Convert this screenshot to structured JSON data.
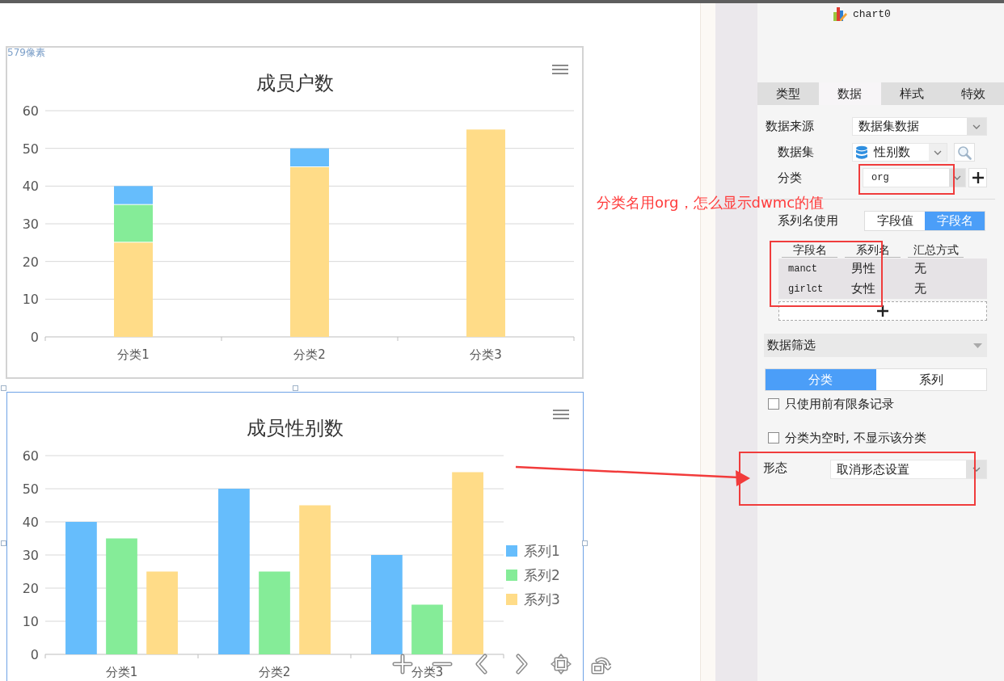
{
  "canvas": {
    "size_label": "579像素",
    "charts": [
      {
        "selected": false,
        "chart_data": {
          "type": "bar",
          "title": "成员户数",
          "categories": [
            "分类1",
            "分类2",
            "分类3"
          ],
          "series": [
            {
              "color": "#ffdc88",
              "values": [
                25,
                45,
                55
              ]
            },
            {
              "color": "#85ec98",
              "values": [
                10,
                null,
                null
              ]
            },
            {
              "color": "#66bdfc",
              "values": [
                5,
                5,
                null
              ]
            }
          ],
          "stacked": true,
          "grid": true,
          "ylim": [
            0,
            60
          ],
          "yticks": [
            0,
            10,
            20,
            30,
            40,
            50,
            60
          ]
        }
      },
      {
        "selected": true,
        "chart_data": {
          "type": "bar",
          "title": "成员性别数",
          "categories": [
            "分类1",
            "分类2",
            "分类3"
          ],
          "series": [
            {
              "name": "系列1",
              "color": "#66bdfc",
              "values": [
                40,
                50,
                30
              ]
            },
            {
              "name": "系列2",
              "color": "#85ec98",
              "values": [
                35,
                25,
                15
              ]
            },
            {
              "name": "系列3",
              "color": "#ffdc88",
              "values": [
                25,
                45,
                55
              ]
            }
          ],
          "stacked": false,
          "grid": true,
          "legend": "right",
          "ylim": [
            0,
            60
          ],
          "yticks": [
            0,
            10,
            20,
            30,
            40,
            50,
            60
          ]
        }
      }
    ]
  },
  "annotation": {
    "text": "分类名用org，怎么显示dwmc的值",
    "arrow": true
  },
  "panel": {
    "title": "chart0",
    "tabs": [
      {
        "label": "类型",
        "selected": false
      },
      {
        "label": "数据",
        "selected": true
      },
      {
        "label": "样式",
        "selected": false
      },
      {
        "label": "特效",
        "selected": false
      }
    ],
    "data_source": {
      "label": "数据来源",
      "value": "数据集数据"
    },
    "dataset": {
      "label": "数据集",
      "value": "性别数"
    },
    "category": {
      "label": "分类",
      "value": "org",
      "highlighted": true
    },
    "series_name_source": {
      "label": "系列名使用",
      "options": [
        {
          "label": "字段值",
          "selected": false
        },
        {
          "label": "字段名",
          "selected": true
        }
      ]
    },
    "fields_table": {
      "highlighted": true,
      "columns": [
        "字段名",
        "系列名",
        "汇总方式"
      ],
      "rows": [
        [
          "manct",
          "男性",
          "无"
        ],
        [
          "girlct",
          "女性",
          "无"
        ]
      ]
    },
    "data_filter": {
      "label": "数据筛选",
      "expanded": false
    },
    "filter_tabs": [
      {
        "label": "分类",
        "selected": true
      },
      {
        "label": "系列",
        "selected": false
      }
    ],
    "checkboxes": [
      {
        "label": "只使用前有限条记录",
        "checked": false
      },
      {
        "label": "分类为空时, 不显示该分类",
        "checked": false
      }
    ],
    "form": {
      "label": "形态",
      "value": "取消形态设置",
      "highlighted": true
    }
  }
}
